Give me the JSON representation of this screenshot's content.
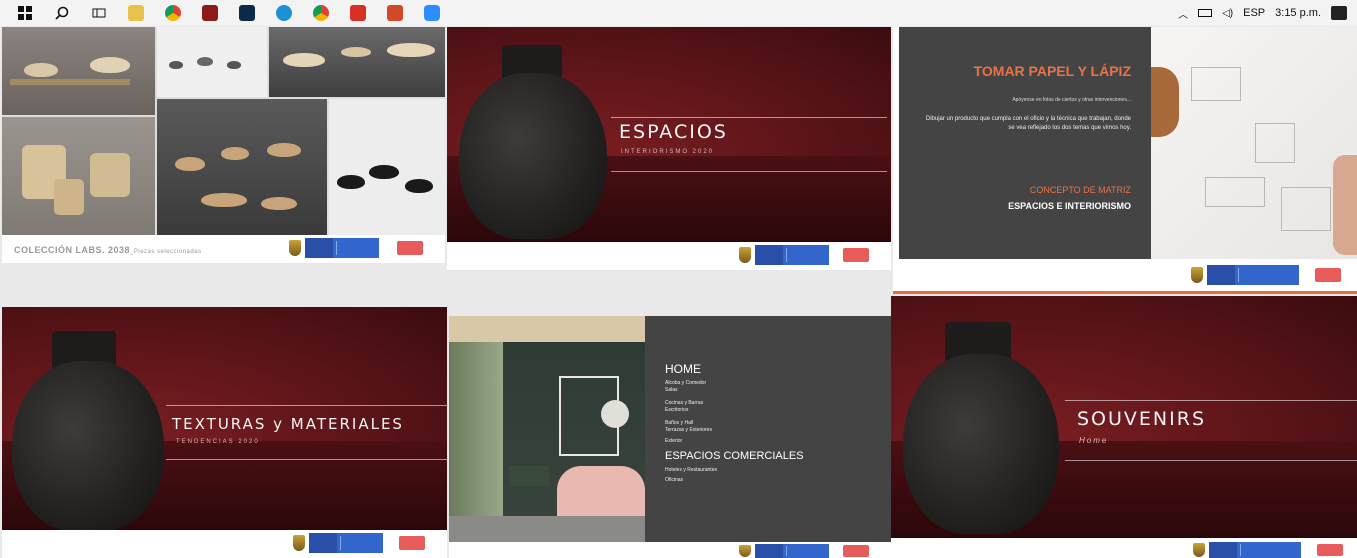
{
  "taskbar": {
    "language": "ESP",
    "clock": "3:15 p.m.",
    "apps": [
      "windows-start",
      "search",
      "task-view",
      "file-explorer",
      "chrome",
      "acrobat",
      "photoshop",
      "edge",
      "chrome-2",
      "pdf-reader",
      "powerpoint",
      "zoom"
    ]
  },
  "tiles": {
    "coleccion": {
      "caption": "COLECCIÓN LABS. 2038",
      "caption_small": "_Piezas seleccionadas"
    },
    "espacios": {
      "title": "ESPACIOS",
      "subtitle": "INTERIORISMO 2020"
    },
    "tomar": {
      "title": "TOMAR PAPEL Y LÁPIZ",
      "intro": "Apóyense en fotos de ciertos y otras intervenciones...",
      "body": "Dibujar un producto que cumpla con el oficio y la técnica que trabajan, donde se vea reflejado los dos temas que vimos hoy.",
      "concept": "CONCEPTO DE MATRIZ",
      "space": "ESPACIOS E INTERIORISMO"
    },
    "texturas": {
      "title": "TEXTURAS y MATERIALES",
      "subtitle": "TENDENCIAS 2020"
    },
    "home": {
      "heading1": "HOME",
      "items1": [
        "Alcoba y Comedor",
        "Salas",
        "Cocinas y Barras",
        "Escritorios",
        "Baños y Hall",
        "Terrazas y Exteriores",
        "Exterior"
      ],
      "heading2": "ESPACIOS COMERCIALES",
      "items2": [
        "Hoteles y Restaurantes",
        "Oficinas"
      ]
    },
    "souvenirs": {
      "title": "SOUVENIRS",
      "subtitle": "Home"
    }
  },
  "colors": {
    "burgundy": "#5a1418",
    "panel": "#444444",
    "accent_orange": "#e8734a",
    "highlight_border": "#ef6a3a"
  }
}
